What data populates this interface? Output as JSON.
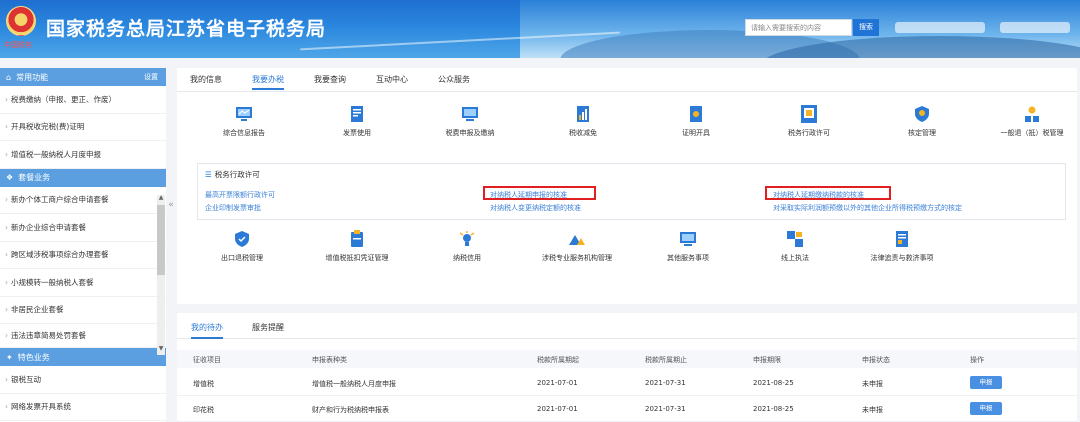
{
  "header": {
    "title": "国家税务总局江苏省电子税务局",
    "logo_text": "中国税务",
    "search_placeholder": "请输入需要搜索的内容",
    "search_button": "搜索"
  },
  "sidebar": {
    "common_title": "常用功能",
    "common_setting": "设置",
    "common_items": [
      "税费缴纳（申报、更正、作废）",
      "开具税收完税(费)证明",
      "增值税一般纳税人月度申报"
    ],
    "package_title": "套餐业务",
    "package_items": [
      "新办个体工商户综合申请套餐",
      "新办企业综合申请套餐",
      "跨区域涉税事项综合办理套餐",
      "小规模转一般纳税人套餐",
      "非居民企业套餐",
      "违法违章简易处罚套餐"
    ],
    "special_title": "特色业务",
    "special_items": [
      "银税互动",
      "网络发票开具系统"
    ]
  },
  "main": {
    "tabs": [
      "我的信息",
      "我要办税",
      "我要查询",
      "互动中心",
      "公众服务"
    ],
    "active_tab": "我要办税",
    "row1": [
      {
        "label": "综合信息报告",
        "icon": "report-icon"
      },
      {
        "label": "发票使用",
        "icon": "invoice-icon"
      },
      {
        "label": "税费申报及缴纳",
        "icon": "declare-icon"
      },
      {
        "label": "税收减免",
        "icon": "reduction-icon"
      },
      {
        "label": "证明开具",
        "icon": "certificate-icon"
      },
      {
        "label": "税务行政许可",
        "icon": "license-icon"
      },
      {
        "label": "核定管理",
        "icon": "shield-icon"
      },
      {
        "label": "一般退（抵）税管理",
        "icon": "refund-icon"
      }
    ],
    "subpanel": {
      "title": "税务行政许可",
      "links": [
        "最高开票限额行政许可",
        "企业印制发票审批",
        "对纳税人延期申报的核准",
        "对纳税人变更纳税定额的核准",
        "对纳税人延期缴纳税款的核准",
        "对采取实际利润额预缴以外的其他企业所得税预缴方式的核定"
      ]
    },
    "row2": [
      {
        "label": "出口退税管理",
        "icon": "export-refund-icon"
      },
      {
        "label": "增值税抵扣凭证管理",
        "icon": "voucher-icon"
      },
      {
        "label": "纳税信用",
        "icon": "credit-icon"
      },
      {
        "label": "涉税专业服务机构管理",
        "icon": "agency-icon"
      },
      {
        "label": "其他服务事项",
        "icon": "monitor-icon"
      },
      {
        "label": "线上执法",
        "icon": "law-icon"
      },
      {
        "label": "法律追责与救济事项",
        "icon": "legal-icon"
      }
    ]
  },
  "bottom": {
    "tabs": [
      "我的待办",
      "服务提醒"
    ],
    "active_tab": "我的待办",
    "columns": [
      "征收项目",
      "申报表种类",
      "税款所属期起",
      "税款所属期止",
      "申报期限",
      "申报状态",
      "操作"
    ],
    "rows": [
      [
        "增值税",
        "增值税一般纳税人月度申报",
        "2021-07-01",
        "2021-07-31",
        "2021-08-25",
        "未申报",
        "申报"
      ],
      [
        "印花税",
        "财产和行为税纳税申报表",
        "2021-07-01",
        "2021-07-31",
        "2021-08-25",
        "未申报",
        "申报"
      ]
    ]
  },
  "colors": {
    "accent": "#2b7ad6",
    "sidebar_section": "#5b9fe0",
    "highlight": "#e02020"
  }
}
